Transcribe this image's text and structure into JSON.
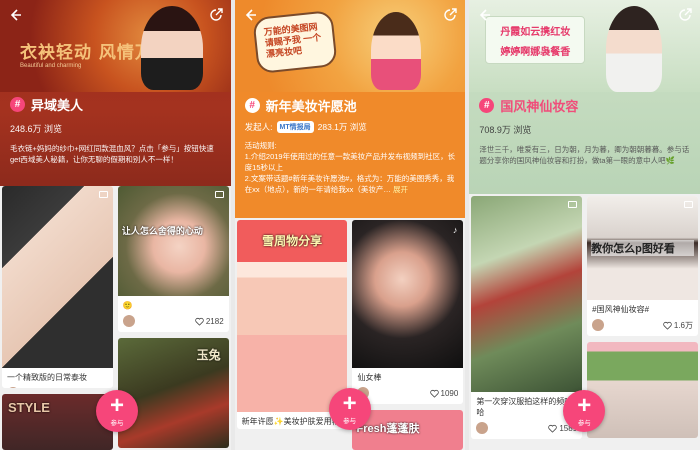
{
  "panels": [
    {
      "banner_text": "衣袂轻动 风情万种",
      "banner_small": "Beautiful and charming",
      "title": "异域美人",
      "views": "248.6万 浏览",
      "desc": "毛衣链+妈妈的纱巾+网红同款混血风？点击「参与」按钮快速get西域美人秘籍，让你无聊的假期和别人不一样！",
      "feed": {
        "col1": [
          {
            "text": "一个精致版的日常泰妆",
            "likes": ""
          },
          {
            "caption": "STYLE",
            "text": ""
          }
        ],
        "col2": [
          {
            "caption": "让人怎么舍得的心动",
            "text": "🙂",
            "likes": "2182"
          },
          {
            "caption": "玉兔",
            "text": ""
          }
        ]
      },
      "fab_label": "参与"
    },
    {
      "banner_text": "万能的美图网 请赐予我 一个漂亮妆吧",
      "title": "新年美妆许愿池",
      "initiator_label": "发起人:",
      "initiator_name": "MT情报局",
      "views": "283.1万 浏览",
      "rules": "活动规则:\n1.介绍2019年使用过的任意一款美妆产品并发布视频到社区，长度15秒以上\n2.文案带话题#新年美妆许愿池#，格式为：万能的美图秀秀，我在xx（地点），新的一年请给我xx（美妆产…",
      "rules_more": "展开",
      "feed": {
        "col1": [
          {
            "caption": "雪周物分享",
            "text": "新年许愿✨美妆护肤爱用物"
          }
        ],
        "col2": [
          {
            "text": "仙女棒",
            "likes": "1090"
          },
          {
            "caption": "Fresh蓬蓬肤",
            "text": ""
          }
        ]
      },
      "fab_label": "参与"
    },
    {
      "banner_text_1": "丹霞如云携红妆",
      "banner_text_2": "婷婷啊娜袅餐香",
      "title": "国风神仙妆容",
      "views": "708.9万 浏览",
      "desc": "泽世三千，唯爱有三，日为朝，月为暮，卿为朝朝暮暮。参与话题分享你的国风神仙妆容和打扮，做ta第一眼的意中人吧🌿",
      "feed": {
        "col1": [
          {
            "text": "第一次穿汉服拍这样的频哈哈",
            "likes": "1589"
          }
        ],
        "col2": [
          {
            "caption": "教你怎么p图好看",
            "text": "#国风神仙妆容#",
            "likes": "1.6万"
          },
          {
            "caption": "",
            "text": ""
          }
        ]
      },
      "fab_label": "参与"
    }
  ]
}
